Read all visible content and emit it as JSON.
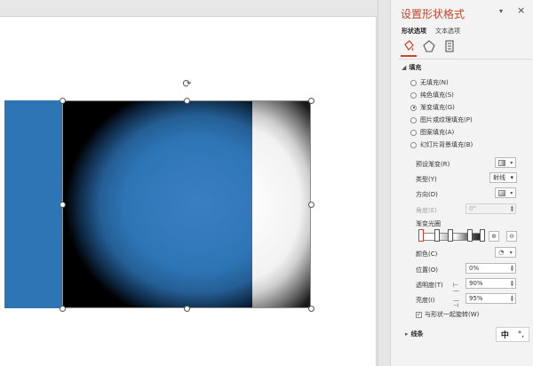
{
  "pane": {
    "title": "设置形状格式",
    "pin": "▾",
    "close": "×",
    "tabs": [
      "形状选项",
      "文本选项"
    ],
    "category_icons": [
      "fill-and-line-icon",
      "effects-icon",
      "size-and-properties-icon"
    ],
    "fill_section": "填充",
    "fill_options": [
      {
        "label": "无填充(N)",
        "selected": false
      },
      {
        "label": "纯色填充(S)",
        "selected": false
      },
      {
        "label": "渐变填充(G)",
        "selected": true
      },
      {
        "label": "图片或纹理填充(P)",
        "selected": false
      },
      {
        "label": "图案填充(A)",
        "selected": false
      },
      {
        "label": "幻灯片背景填充(B)",
        "selected": false
      }
    ],
    "preset_gradient": "预设渐变(R)",
    "type_label": "类型(Y)",
    "type_value": "射线",
    "direction_label": "方向(D)",
    "angle_label": "角度(E)",
    "angle_value": "0°",
    "gradient_stops": "渐变光圈",
    "color_label": "颜色(C)",
    "position_label": "位置(O)",
    "position_value": "0%",
    "transparency_label": "透明度(T)",
    "transparency_value": "90%",
    "brightness_label": "亮度(I)",
    "brightness_value": "95%",
    "rotate_with_shape": "与形状一起旋转(W)",
    "rotate_checked": true,
    "line_section": "线条",
    "bottom_tool_1": "中",
    "bottom_tool_2": "°,"
  },
  "colors": {
    "accent": "#c5442a",
    "shape_blue": "#2e75b6"
  }
}
